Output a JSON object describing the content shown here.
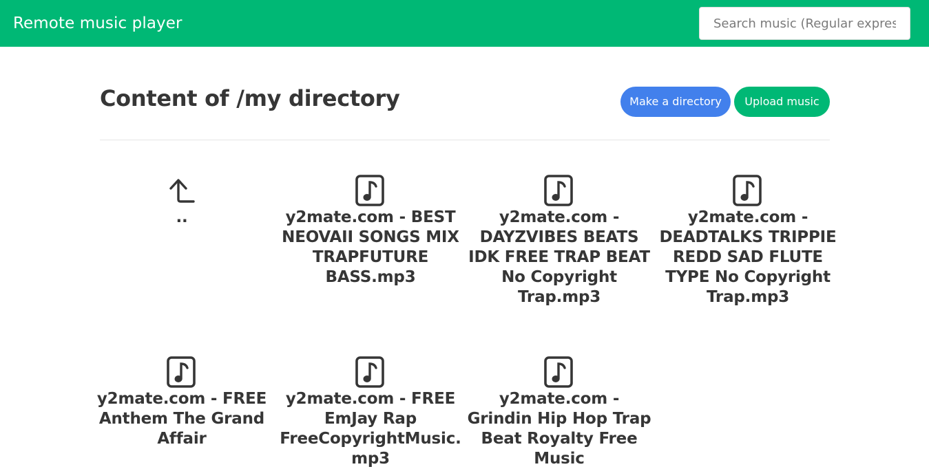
{
  "header": {
    "brand": "Remote music player",
    "search_placeholder": "Search music (Regular expression)"
  },
  "main": {
    "title": "Content of /my directory",
    "make_directory_label": "Make a directory",
    "upload_music_label": "Upload music"
  },
  "colors": {
    "brand_green": "#00b875",
    "primary_blue": "#4280ec",
    "text_dark": "#363636"
  },
  "items": [
    {
      "icon": "arrow-up-left-icon",
      "name": ".."
    },
    {
      "icon": "music-file-icon",
      "name": "y2mate.com - BEST NEOVAII SONGS MIX TRAPFUTURE BASS.mp3"
    },
    {
      "icon": "music-file-icon",
      "name": "y2mate.com - DAYZVIBES BEATS IDK FREE TRAP BEAT No Copyright Trap.mp3"
    },
    {
      "icon": "music-file-icon",
      "name": "y2mate.com - DEADTALKS TRIPPIE REDD SAD FLUTE TYPE No Copyright Trap.mp3"
    },
    {
      "icon": "music-file-icon",
      "name": "y2mate.com - FREE Anthem The Grand Affair"
    },
    {
      "icon": "music-file-icon",
      "name": "y2mate.com - FREE EmJay Rap FreeCopyrightMusic.mp3"
    },
    {
      "icon": "music-file-icon",
      "name": "y2mate.com - Grindin Hip Hop Trap Beat Royalty Free Music"
    }
  ]
}
